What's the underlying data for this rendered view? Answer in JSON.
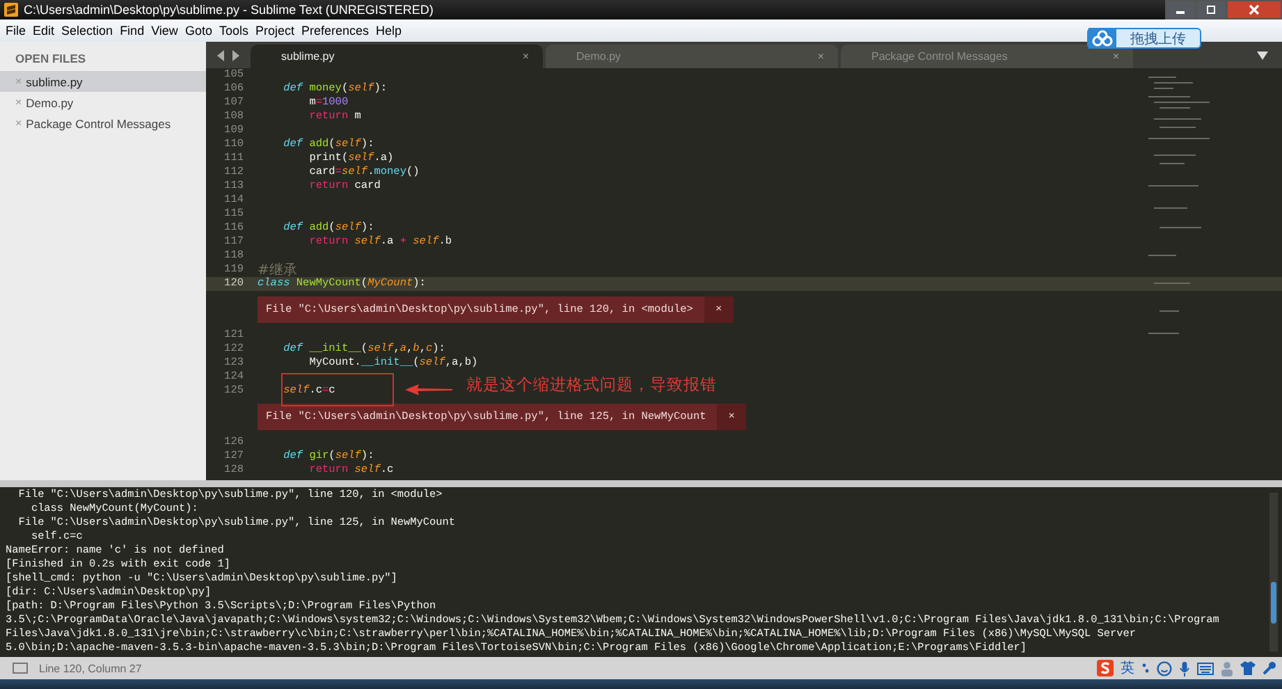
{
  "window": {
    "title": "C:\\Users\\admin\\Desktop\\py\\sublime.py - Sublime Text (UNREGISTERED)"
  },
  "menu": [
    "File",
    "Edit",
    "Selection",
    "Find",
    "View",
    "Goto",
    "Tools",
    "Project",
    "Preferences",
    "Help"
  ],
  "sidebar": {
    "header": "OPEN FILES",
    "items": [
      {
        "close": "×",
        "label": "sublime.py",
        "selected": true
      },
      {
        "close": "×",
        "label": "Demo.py",
        "selected": false
      },
      {
        "close": "×",
        "label": "Package Control Messages",
        "selected": false
      }
    ]
  },
  "tabs": [
    {
      "label": "sublime.py",
      "close": "×",
      "selected": true
    },
    {
      "label": "Demo.py",
      "close": "×",
      "selected": false
    },
    {
      "label": "Package Control Messages",
      "close": "×",
      "selected": false
    }
  ],
  "upload_button": {
    "label": "拖拽上传"
  },
  "editor": {
    "lines": [
      {
        "kind": "blank",
        "num": "105",
        "current": false
      },
      {
        "kind": "method",
        "num": "106",
        "current": false,
        "tokens": [
          {
            "text": "def ",
            "kind": "keyword"
          },
          {
            "text": "money",
            "kind": "func"
          },
          {
            "text": "(",
            "kind": "plain"
          },
          {
            "text": "self",
            "kind": "param"
          },
          {
            "text": "):",
            "kind": "plain"
          }
        ]
      },
      {
        "kind": "body",
        "num": "107",
        "current": false,
        "tokens": [
          {
            "text": "m",
            "kind": "plain"
          },
          {
            "text": "=",
            "kind": "op"
          },
          {
            "text": "1000",
            "kind": "number"
          }
        ]
      },
      {
        "kind": "body",
        "num": "108",
        "current": false,
        "tokens": [
          {
            "text": "return ",
            "kind": "op"
          },
          {
            "text": "m",
            "kind": "plain"
          }
        ]
      },
      {
        "kind": "blank",
        "num": "109",
        "current": false
      },
      {
        "kind": "method",
        "num": "110",
        "current": false,
        "tokens": [
          {
            "text": "def ",
            "kind": "keyword"
          },
          {
            "text": "add",
            "kind": "func"
          },
          {
            "text": "(",
            "kind": "plain"
          },
          {
            "text": "self",
            "kind": "param"
          },
          {
            "text": "):",
            "kind": "plain"
          }
        ]
      },
      {
        "kind": "body",
        "num": "111",
        "current": false,
        "tokens": [
          {
            "text": "print(",
            "kind": "plain"
          },
          {
            "text": "self",
            "kind": "param"
          },
          {
            "text": ".a)",
            "kind": "plain"
          }
        ]
      },
      {
        "kind": "body",
        "num": "112",
        "current": false,
        "tokens": [
          {
            "text": "card",
            "kind": "plain"
          },
          {
            "text": "=",
            "kind": "op"
          },
          {
            "text": "self",
            "kind": "param"
          },
          {
            "text": ".",
            "kind": "plain"
          },
          {
            "text": "money",
            "kind": "call"
          },
          {
            "text": "()",
            "kind": "plain"
          }
        ]
      },
      {
        "kind": "body",
        "num": "113",
        "current": false,
        "tokens": [
          {
            "text": "return ",
            "kind": "op"
          },
          {
            "text": "card",
            "kind": "plain"
          }
        ]
      },
      {
        "kind": "blank",
        "num": "114",
        "current": false
      },
      {
        "kind": "blank",
        "num": "115",
        "current": false
      },
      {
        "kind": "method",
        "num": "116",
        "current": false,
        "tokens": [
          {
            "text": "def ",
            "kind": "keyword"
          },
          {
            "text": "add",
            "kind": "func"
          },
          {
            "text": "(",
            "kind": "plain"
          },
          {
            "text": "self",
            "kind": "param"
          },
          {
            "text": "):",
            "kind": "plain"
          }
        ]
      },
      {
        "kind": "body",
        "num": "117",
        "current": false,
        "tokens": [
          {
            "text": "return ",
            "kind": "op"
          },
          {
            "text": "self",
            "kind": "param"
          },
          {
            "text": ".a ",
            "kind": "plain"
          },
          {
            "text": "+ ",
            "kind": "op"
          },
          {
            "text": "self",
            "kind": "param"
          },
          {
            "text": ".b",
            "kind": "plain"
          }
        ]
      },
      {
        "kind": "blank",
        "num": "118",
        "current": false
      },
      {
        "kind": "top",
        "num": "119",
        "current": false,
        "tokens": [
          {
            "text": "#继承",
            "kind": "comment"
          }
        ]
      },
      {
        "kind": "top",
        "num": "120",
        "current": true,
        "tokens": [
          {
            "text": "class ",
            "kind": "keyword"
          },
          {
            "text": "NewMyCount",
            "kind": "func"
          },
          {
            "text": "(",
            "kind": "plain"
          },
          {
            "text": "MyCount",
            "kind": "param"
          },
          {
            "text": "):",
            "kind": "plain"
          }
        ]
      },
      {
        "kind": "error",
        "text": "File \"C:\\Users\\admin\\Desktop\\py\\sublime.py\", line 120, in <module>",
        "close": "×"
      },
      {
        "kind": "blank",
        "num": "121",
        "current": false
      },
      {
        "kind": "method",
        "num": "122",
        "current": false,
        "tokens": [
          {
            "text": "def ",
            "kind": "keyword"
          },
          {
            "text": "__init__",
            "kind": "func"
          },
          {
            "text": "(",
            "kind": "plain"
          },
          {
            "text": "self",
            "kind": "param"
          },
          {
            "text": ",",
            "kind": "plain"
          },
          {
            "text": "a",
            "kind": "param"
          },
          {
            "text": ",",
            "kind": "plain"
          },
          {
            "text": "b",
            "kind": "param"
          },
          {
            "text": ",",
            "kind": "plain"
          },
          {
            "text": "c",
            "kind": "param"
          },
          {
            "text": "):",
            "kind": "plain"
          }
        ]
      },
      {
        "kind": "body",
        "num": "123",
        "current": false,
        "tokens": [
          {
            "text": "MyCount.",
            "kind": "plain"
          },
          {
            "text": "__init__",
            "kind": "call"
          },
          {
            "text": "(",
            "kind": "plain"
          },
          {
            "text": "self",
            "kind": "param"
          },
          {
            "text": ",a,b)",
            "kind": "plain"
          }
        ]
      },
      {
        "kind": "blank",
        "num": "124",
        "current": false
      },
      {
        "kind": "method",
        "num": "125",
        "current": false,
        "tokens": [
          {
            "text": "self",
            "kind": "param"
          },
          {
            "text": ".c",
            "kind": "plain"
          },
          {
            "text": "=",
            "kind": "op"
          },
          {
            "text": "c",
            "kind": "plain"
          }
        ]
      },
      {
        "kind": "error",
        "text": "File \"C:\\Users\\admin\\Desktop\\py\\sublime.py\", line 125, in NewMyCount",
        "close": "×"
      },
      {
        "kind": "blank",
        "num": "126",
        "current": false
      },
      {
        "kind": "method",
        "num": "127",
        "current": false,
        "tokens": [
          {
            "text": "def ",
            "kind": "keyword"
          },
          {
            "text": "gir",
            "kind": "func"
          },
          {
            "text": "(",
            "kind": "plain"
          },
          {
            "text": "self",
            "kind": "param"
          },
          {
            "text": "):",
            "kind": "plain"
          }
        ]
      },
      {
        "kind": "body",
        "num": "128",
        "current": false,
        "tokens": [
          {
            "text": "return ",
            "kind": "op"
          },
          {
            "text": "self",
            "kind": "param"
          },
          {
            "text": ".c",
            "kind": "plain"
          }
        ]
      }
    ],
    "annotation": {
      "text": "就是这个缩进格式问题，导致报错"
    }
  },
  "output": {
    "lines": [
      "  File \"C:\\Users\\admin\\Desktop\\py\\sublime.py\", line 120, in <module>",
      "    class NewMyCount(MyCount):",
      "  File \"C:\\Users\\admin\\Desktop\\py\\sublime.py\", line 125, in NewMyCount",
      "    self.c=c",
      "NameError: name 'c' is not defined",
      "[Finished in 0.2s with exit code 1]",
      "[shell_cmd: python -u \"C:\\Users\\admin\\Desktop\\py\\sublime.py\"]",
      "[dir: C:\\Users\\admin\\Desktop\\py]",
      "[path: D:\\Program Files\\Python 3.5\\Scripts\\;D:\\Program Files\\Python",
      "3.5\\;C:\\ProgramData\\Oracle\\Java\\javapath;C:\\Windows\\system32;C:\\Windows;C:\\Windows\\System32\\Wbem;C:\\Windows\\System32\\WindowsPowerShell\\v1.0;C:\\Program Files\\Java\\jdk1.8.0_131\\bin;C:\\Program",
      "Files\\Java\\jdk1.8.0_131\\jre\\bin;C:\\strawberry\\c\\bin;C:\\strawberry\\perl\\bin;%CATALINA_HOME%\\bin;%CATALINA_HOME%\\bin;%CATALINA_HOME%\\lib;D:\\Program Files (x86)\\MySQL\\MySQL Server",
      "5.0\\bin;D:\\apache-maven-3.5.3-bin\\apache-maven-3.5.3\\bin;D:\\Program Files\\TortoiseSVN\\bin;C:\\Program Files (x86)\\Google\\Chrome\\Application;E:\\Programs\\Fiddler]"
    ]
  },
  "status_bar": {
    "text": "Line 120, Column 27"
  },
  "ime_toolbar": {
    "language": "英"
  }
}
